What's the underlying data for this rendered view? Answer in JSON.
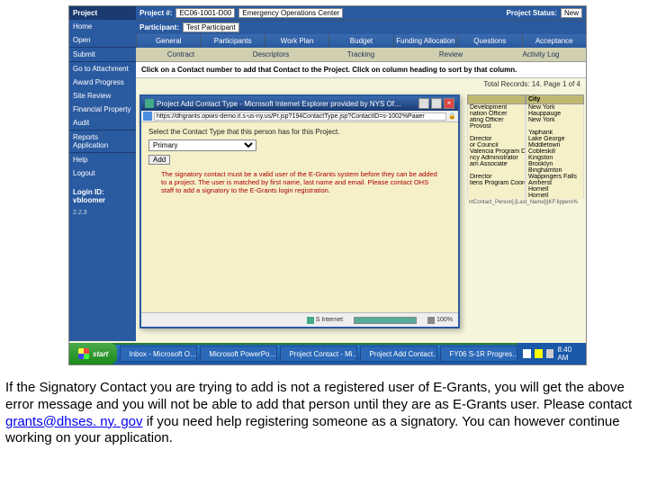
{
  "sidebar": {
    "header": "Project",
    "items": [
      "Home",
      "Open",
      "Submit",
      "Go to Attachment",
      "Award Progress",
      "Site Review",
      "Financial Property",
      "Audit",
      "Reports Application",
      "Help",
      "Logout"
    ],
    "login_label": "Login ID:",
    "login_user": "vbloomer",
    "version": "2.2.3"
  },
  "topbar": {
    "project_num_label": "Project #:",
    "project_num": "EC06-1001-D00",
    "project_name": "Emergency Operations Center",
    "participant_label": "Participant:",
    "participant": "Test Participant",
    "status_label": "Project Status:",
    "status": "New"
  },
  "tabs_primary": [
    "General",
    "Participants",
    "Work Plan",
    "Budget",
    "Funding Allocation",
    "Questions",
    "Acceptance"
  ],
  "tabs_secondary": [
    "Contract",
    "Descriptors",
    "Tracking",
    "Review",
    "Activity Log"
  ],
  "instruction": "Click on a Contact number to add that Contact to the Project. Click on column heading to sort by that column.",
  "records_summary": "Total Records: 14. Page 1 of 4",
  "table": {
    "col_role": "",
    "col_city": "City",
    "rows": [
      {
        "role": "Development",
        "city": "New York"
      },
      {
        "role": "nation Officer",
        "city": "Hauppauge"
      },
      {
        "role": "ating Officer",
        "city": "New York"
      },
      {
        "role": "Provost",
        "city": ""
      },
      {
        "role": "",
        "city": "Yaphank"
      },
      {
        "role": "Director",
        "city": "Lake George"
      },
      {
        "role": "or Council",
        "city": "Middletown"
      },
      {
        "role": "Valencia Program Director",
        "city": "Cobleskill"
      },
      {
        "role": "ncy Administrator",
        "city": "Kingston"
      },
      {
        "role": "am Associate",
        "city": "Brooklyn"
      },
      {
        "role": "",
        "city": "Binghamton"
      },
      {
        "role": "Director",
        "city": "Wappingers Falls"
      },
      {
        "role": "liens Program Coordinator",
        "city": "Amherst"
      },
      {
        "role": "",
        "city": "Hornell"
      },
      {
        "role": "",
        "city": "Hornell"
      }
    ],
    "footer": "ntContact_Person].[Last_Name]||KF:lipperv%"
  },
  "popup": {
    "title": "Project Add Contact Type - Microsoft Internet Explorer provided by NYS Of…",
    "url": "https://dhgrants.opwis-demo.it.s-us-ny.us/Pr.jsp?194ContactType.jsp?ContactID=s-1002%Paaer",
    "prompt": "Select the Contact Type that this person has for this Project.",
    "select_options": [
      "Primary"
    ],
    "select_value": "Primary",
    "add_button": "Add",
    "error": "The signatory contact must be a valid user of the E-Grants system before they can be added to a project. The user is matched by first name, last name and email. Please contact OHS staff to add a signatory to the E-Grants login registration.",
    "status_site": "S Internet",
    "status_zoom": "100%"
  },
  "taskbar": {
    "start": "start",
    "items": [
      "Inbox - Microsoft O…",
      "Microsoft PowerPo…",
      "Project Contact - Mi…",
      "Project Add Contact…",
      "FY06 S-1R Progres…"
    ],
    "time": "8:40 AM"
  },
  "caption": {
    "t1": "If the Signatory Contact you are trying to add is not a registered user of E-Grants, you will get the above error message and you will not be able to add that person until they are as E-Grants user.  Please contact ",
    "email": "grants@dhses. ny. gov",
    "t2": " if you need help registering someone as a signatory.  You can however continue working on your application."
  }
}
